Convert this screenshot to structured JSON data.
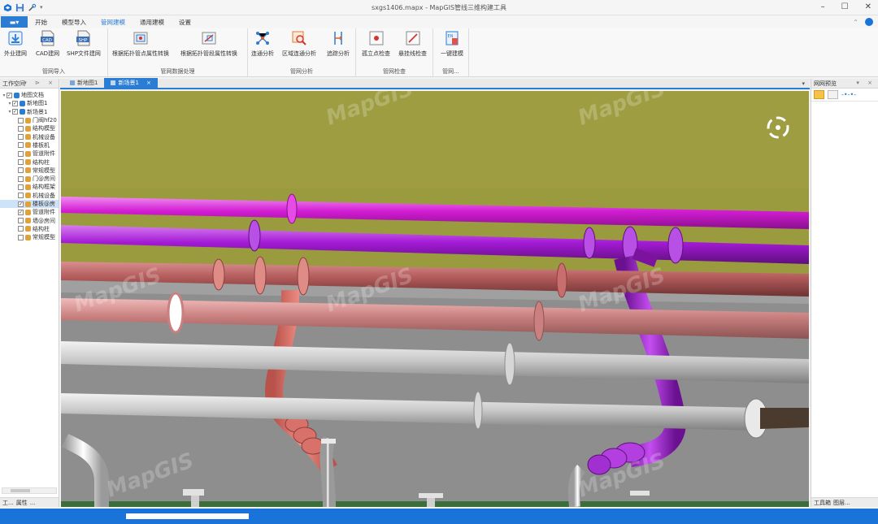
{
  "window": {
    "title": "sxgs1406.mapx - MapGIS管线三维构建工具",
    "minimize": "–",
    "maximize": "☐",
    "close": "✕"
  },
  "ribbon_tabs": {
    "file": "▬▾",
    "items": [
      "开始",
      "模型导入",
      "管网建模",
      "通用建模",
      "设置"
    ],
    "active_index": 2
  },
  "ribbon": {
    "groups": [
      {
        "label": "管网导入",
        "buttons": [
          "外业建网",
          "CAD建网",
          "SHP文件建网"
        ]
      },
      {
        "label": "管网数据处理",
        "buttons": [
          "根据拓扑管点属性转换",
          "根据拓扑管段属性转换"
        ]
      },
      {
        "label": "管网分析",
        "buttons": [
          "连通分析",
          "区域连通分析",
          "追踪分析"
        ]
      },
      {
        "label": "管网检查",
        "buttons": [
          "孤立点检查",
          "悬挂线检查"
        ]
      },
      {
        "label": "管网...",
        "buttons": [
          "一键建模"
        ]
      }
    ]
  },
  "workspace": {
    "title": "工作空间",
    "tree": [
      {
        "label": "地图文档",
        "level": 0,
        "checked": true
      },
      {
        "label": "新地图1",
        "level": 1,
        "checked": true
      },
      {
        "label": "新场景1",
        "level": 1,
        "checked": true
      },
      {
        "label": "门阀hf20",
        "level": 2,
        "checked": false
      },
      {
        "label": "结构模型",
        "level": 2,
        "checked": false
      },
      {
        "label": "机械设备",
        "level": 2,
        "checked": false
      },
      {
        "label": "楼板机",
        "level": 2,
        "checked": false
      },
      {
        "label": "管道附件",
        "level": 2,
        "checked": false
      },
      {
        "label": "结构柱",
        "level": 2,
        "checked": false
      },
      {
        "label": "常规模型",
        "level": 2,
        "checked": false
      },
      {
        "label": "门@房间",
        "level": 2,
        "checked": false
      },
      {
        "label": "结构框架",
        "level": 2,
        "checked": false
      },
      {
        "label": "机械设备",
        "level": 2,
        "checked": false
      },
      {
        "label": "楼板@房",
        "level": 2,
        "checked": true,
        "selected": true
      },
      {
        "label": "管道附件",
        "level": 2,
        "checked": true
      },
      {
        "label": "墙@房间",
        "level": 2,
        "checked": false
      },
      {
        "label": "结构柱",
        "level": 2,
        "checked": false
      },
      {
        "label": "常规模型",
        "level": 2,
        "checked": false
      }
    ],
    "bottom_tabs": [
      "工...",
      "属性",
      "..."
    ]
  },
  "doc_tabs": [
    {
      "label": "新地图1",
      "active": false
    },
    {
      "label": "新场景1",
      "active": true,
      "close": "×"
    }
  ],
  "doc_tabs_menu": "▾",
  "scene": {
    "watermark": "MapGIS",
    "nav_icon": "navigation-ring-icon",
    "pipe_colors": {
      "magenta": "#d21cd3",
      "purple": "#a31ad6",
      "dark_red": "#b35b5b",
      "pink": "#c9807f",
      "gray": "#c9c9c9",
      "salmon": "#e57a72",
      "wall": "#9a9a3f",
      "floor": "#8e8e8e"
    }
  },
  "right_panel": {
    "title": "网网预览",
    "bottom_tabs": [
      "工具箱",
      "图层..."
    ]
  },
  "status": {
    "progress": 0.15
  }
}
